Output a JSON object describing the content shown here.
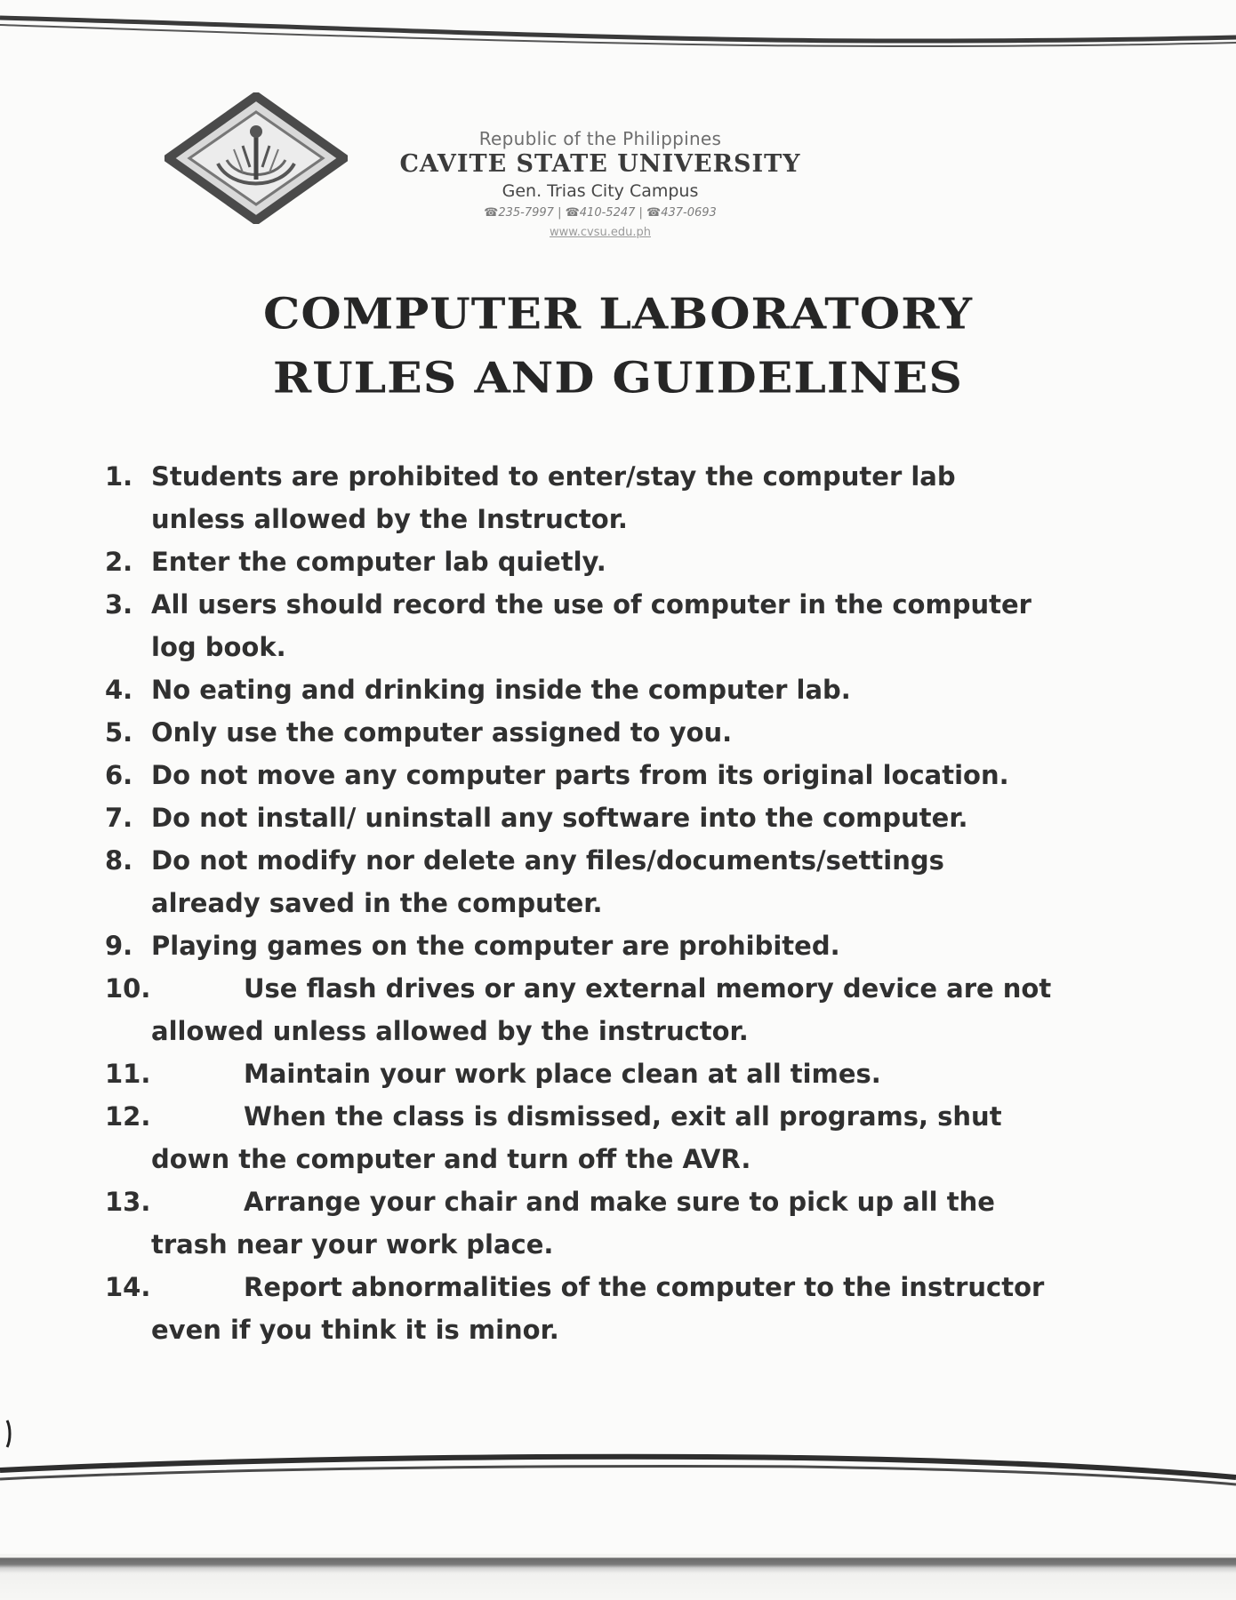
{
  "letterhead": {
    "republic": "Republic of the Philippines",
    "university": "CAVITE STATE UNIVERSITY",
    "campus": "Gen. Trias City Campus",
    "contacts": "☎235-7997 | ☎410-5247 | ☎437-0693",
    "website": "www.cvsu.edu.ph"
  },
  "title": {
    "line1": "COMPUTER LABORATORY",
    "line2": "RULES AND GUIDELINES"
  },
  "rules": [
    {
      "num": "1.",
      "line1": "Students are prohibited to enter/stay the computer lab",
      "line2": "unless allowed by the Instructor."
    },
    {
      "num": "2.",
      "line1": "Enter the computer lab quietly.",
      "line2": ""
    },
    {
      "num": "3.",
      "line1": "All users should record the use of computer in the computer",
      "line2": "log book."
    },
    {
      "num": "4.",
      "line1": "No eating and drinking inside the computer lab.",
      "line2": ""
    },
    {
      "num": "5.",
      "line1": "Only use the computer assigned to you.",
      "line2": ""
    },
    {
      "num": "6.",
      "line1": "Do not move any computer parts from its original location.",
      "line2": ""
    },
    {
      "num": "7.",
      "line1": "Do not install/ uninstall any software into the computer.",
      "line2": ""
    },
    {
      "num": "8.",
      "line1": "Do not modify nor delete any files/documents/settings",
      "line2": "already saved in the computer."
    },
    {
      "num": "9.",
      "line1": "Playing games on the computer are prohibited.",
      "line2": ""
    },
    {
      "num": "10.",
      "line1": "Use flash drives or any external memory device are not",
      "line2": "allowed unless allowed by the instructor."
    },
    {
      "num": "11.",
      "line1": "Maintain your work place clean at all times.",
      "line2": ""
    },
    {
      "num": "12.",
      "line1": "When the class is dismissed, exit all programs, shut",
      "line2": "down the computer and turn off the AVR."
    },
    {
      "num": "13.",
      "line1": "Arrange your chair and make sure to pick up all the",
      "line2": "trash near your work place."
    },
    {
      "num": "14.",
      "line1": "Report abnormalities of the computer to the instructor",
      "line2": "even if you think it is minor."
    }
  ]
}
